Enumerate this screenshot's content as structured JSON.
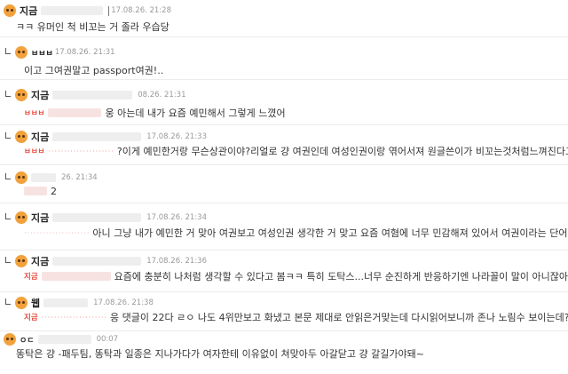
{
  "comments": [
    {
      "nick": "지금",
      "date": "17.08.26. 21:28",
      "text": "ㅋㅋ 유머인 척 비꼬는 거 졸라 우습당",
      "reply": false
    },
    {
      "nick": "ㅂㅂㅂ",
      "date": "17.08.26. 21:31",
      "text": "이고 그여권말고 passport여권!..",
      "reply": true
    },
    {
      "nick": "지금",
      "date": "08.26. 21:31",
      "tag": "ㅂㅂㅂ",
      "text": "웅 아는데 내가 요즘 예민해서 그렇게 느꼈어",
      "reply": true
    },
    {
      "nick": "지금",
      "date": "17.08.26. 21:33",
      "tag": "ㅂㅂㅂ",
      "text": "?이게 예민한거랑 무슨상관이야?리얼로 걍 여권인데 여성인권이랑 엮어서져 원글쓴이가 비꼬는것처럼느껴진다고?",
      "reply": true
    },
    {
      "nick": "",
      "date": "26. 21:34",
      "text": "2",
      "reply": true
    },
    {
      "nick": "지금",
      "date": "17.08.26. 21:34",
      "text": "아니 그냥 내가 예민한 거 맞아 여권보고 여성인권 생각한 거 맞고 요즘 여혐에 너무 민감해져 있어서 여권이라는 단어에만 민감한",
      "reply": true
    },
    {
      "nick": "지금",
      "date": "17.08.26. 21:36",
      "tag": "지금",
      "text": "요즘에 충분히 나처럼 생각할 수 있다고 봄ㅋㅋ 특히 도탁스...너무 순진하게 반응하기엔 나라꼴이 말이 아니잖아",
      "reply": true
    },
    {
      "nick": "웹",
      "date": "17.08.26. 21:38",
      "tag": "지금",
      "text": "응 댓글이 22다 ㄹㅇ 나도 4위만보고 화냈고 본문 제대로 안읽은거맞는데 다시읽어보니까 존나 노림수 보이는데?",
      "reply": true
    },
    {
      "nick": "ㅇㄷ",
      "date": "00:07",
      "text": "똥탁은 걍 -패두팀, 똥탁과 일종은 지나가다가 여자한테 이유없이 쳐맞아두 아갈닫고 걍 갈길가야돼~",
      "reply": false
    }
  ]
}
